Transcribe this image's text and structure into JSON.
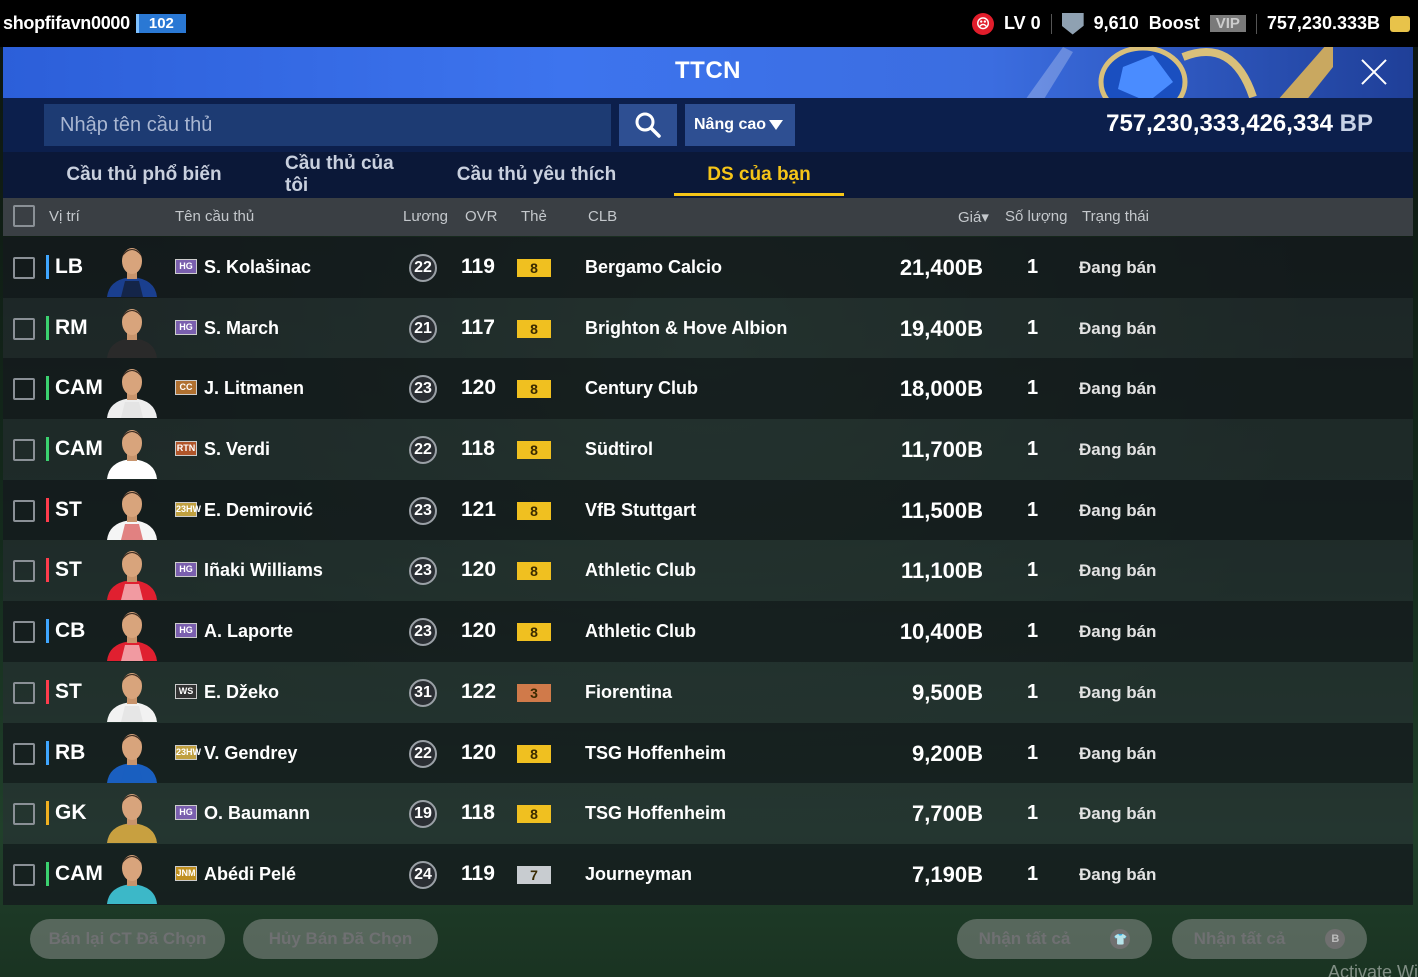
{
  "topbar": {
    "username": "shopfifavn0000",
    "user_level": "102",
    "lv_label": "LV 0",
    "shield_count": "9,610",
    "boost_label": "Boost",
    "vip_label": "VIP",
    "currency_total": "757,230.333B"
  },
  "header": {
    "title": "TTCN"
  },
  "search": {
    "placeholder": "Nhập tên cầu thủ",
    "advanced_label": "Nâng cao",
    "bp_value": "757,230,333,426,334",
    "bp_unit": "BP"
  },
  "tabs": [
    {
      "label": "Cầu thủ phổ biến",
      "active": false
    },
    {
      "label": "Cầu thủ của tôi",
      "active": false
    },
    {
      "label": "Cầu thủ yêu thích",
      "active": false
    },
    {
      "label": "DS của bạn",
      "active": true
    }
  ],
  "columns": {
    "position": "Vị trí",
    "name": "Tên cầu thủ",
    "salary": "Lương",
    "ovr": "OVR",
    "card": "Thẻ",
    "club": "CLB",
    "price": "Giá▾",
    "quantity": "Số lượng",
    "status": "Trạng thái"
  },
  "rows": [
    {
      "pos": "LB",
      "line": "def",
      "season": "HG",
      "season_color": "#7a5fae",
      "name": "S. Kolašinac",
      "salary": "22",
      "ovr": "119",
      "card": "8",
      "card_color": "#f0c020",
      "club": "Bergamo Calcio",
      "price": "21,400B",
      "qty": "1",
      "status": "Đang bán",
      "kit": "#1a3f8f",
      "kit2": "#111"
    },
    {
      "pos": "RM",
      "line": "mid",
      "season": "HG",
      "season_color": "#7a5fae",
      "name": "S. March",
      "salary": "21",
      "ovr": "117",
      "card": "8",
      "card_color": "#f0c020",
      "club": "Brighton & Hove Albion",
      "price": "19,400B",
      "qty": "1",
      "status": "Đang bán",
      "kit": "#2a2a2a",
      "kit2": "#2a2a2a"
    },
    {
      "pos": "CAM",
      "line": "mid",
      "season": "CC",
      "season_color": "#b07030",
      "name": "J. Litmanen",
      "salary": "23",
      "ovr": "120",
      "card": "8",
      "card_color": "#f0c020",
      "club": "Century Club",
      "price": "18,000B",
      "qty": "1",
      "status": "Đang bán",
      "kit": "#eeeeee",
      "kit2": "#ddd"
    },
    {
      "pos": "CAM",
      "line": "mid",
      "season": "RTN",
      "season_color": "#b0552a",
      "name": "S. Verdi",
      "salary": "22",
      "ovr": "118",
      "card": "8",
      "card_color": "#f0c020",
      "club": "Südtirol",
      "price": "11,700B",
      "qty": "1",
      "status": "Đang bán",
      "kit": "#ffffff",
      "kit2": "#ffffff"
    },
    {
      "pos": "ST",
      "line": "att",
      "season": "23HW",
      "season_color": "#c0a040",
      "name": "E. Demirović",
      "salary": "23",
      "ovr": "121",
      "card": "8",
      "card_color": "#f0c020",
      "club": "VfB Stuttgart",
      "price": "11,500B",
      "qty": "1",
      "status": "Đang bán",
      "kit": "#f5f5f5",
      "kit2": "#d02020"
    },
    {
      "pos": "ST",
      "line": "att",
      "season": "HG",
      "season_color": "#7a5fae",
      "name": "Iñaki Williams",
      "salary": "23",
      "ovr": "120",
      "card": "8",
      "card_color": "#f0c020",
      "club": "Athletic Club",
      "price": "11,100B",
      "qty": "1",
      "status": "Đang bán",
      "kit": "#e02030",
      "kit2": "#ffffff"
    },
    {
      "pos": "CB",
      "line": "def",
      "season": "HG",
      "season_color": "#7a5fae",
      "name": "A. Laporte",
      "salary": "23",
      "ovr": "120",
      "card": "8",
      "card_color": "#f0c020",
      "club": "Athletic Club",
      "price": "10,400B",
      "qty": "1",
      "status": "Đang bán",
      "kit": "#e02030",
      "kit2": "#ffffff"
    },
    {
      "pos": "ST",
      "line": "att",
      "season": "WS",
      "season_color": "#333333",
      "name": "E. Džeko",
      "salary": "31",
      "ovr": "122",
      "card": "3",
      "card_color": "#d07a4a",
      "club": "Fiorentina",
      "price": "9,500B",
      "qty": "1",
      "status": "Đang bán",
      "kit": "#f2f2f2",
      "kit2": "#ddd"
    },
    {
      "pos": "RB",
      "line": "def",
      "season": "23HW",
      "season_color": "#c0a040",
      "name": "V. Gendrey",
      "salary": "22",
      "ovr": "120",
      "card": "8",
      "card_color": "#f0c020",
      "club": "TSG Hoffenheim",
      "price": "9,200B",
      "qty": "1",
      "status": "Đang bán",
      "kit": "#1a5fc0",
      "kit2": "#1a5fc0"
    },
    {
      "pos": "GK",
      "line": "gk",
      "season": "HG",
      "season_color": "#7a5fae",
      "name": "O. Baumann",
      "salary": "19",
      "ovr": "118",
      "card": "8",
      "card_color": "#f0c020",
      "club": "TSG Hoffenheim",
      "price": "7,700B",
      "qty": "1",
      "status": "Đang bán",
      "kit": "#c8a040",
      "kit2": "#c8a040"
    },
    {
      "pos": "CAM",
      "line": "mid",
      "season": "JNM",
      "season_color": "#c09020",
      "name": "Abédi Pelé",
      "salary": "24",
      "ovr": "119",
      "card": "7",
      "card_color": "#c8ccd0",
      "club": "Journeyman",
      "price": "7,190B",
      "qty": "1",
      "status": "Đang bán",
      "kit": "#3cb8c8",
      "kit2": "#3cb8c8"
    }
  ],
  "bottom": {
    "resell_label": "Bán lại CT Đã Chọn",
    "cancel_label": "Hủy Bán Đã Chọn",
    "claim_all_label": "Nhận tất cả",
    "claim_all_bp_label": "Nhận tất cả"
  },
  "watermark": "Activate Wi"
}
